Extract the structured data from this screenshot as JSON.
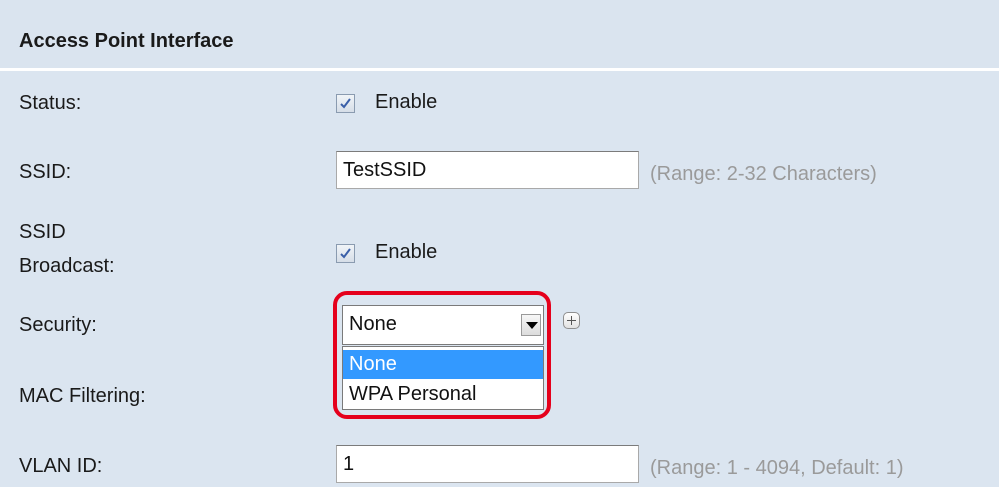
{
  "section": {
    "title": "Access Point Interface"
  },
  "status": {
    "label": "Status:",
    "checked": true,
    "option_label": "Enable"
  },
  "ssid": {
    "label": "SSID:",
    "value": "TestSSID",
    "hint": "(Range: 2-32 Characters)"
  },
  "ssid_broadcast": {
    "label_line1": "SSID",
    "label_line2": "Broadcast:",
    "checked": true,
    "option_label": "Enable"
  },
  "security": {
    "label": "Security:",
    "selected": "None",
    "options": [
      "None",
      "WPA Personal"
    ],
    "highlight_color": "#e5001c",
    "selected_option_color": "#3399ff"
  },
  "mac_filtering": {
    "label": "MAC Filtering:"
  },
  "vlan": {
    "label": "VLAN ID:",
    "value": "1",
    "hint": "(Range: 1 - 4094, Default: 1)"
  },
  "icons": {
    "checkbox": "check-icon",
    "expand": "plus-icon",
    "dropdown": "chevron-down-icon"
  }
}
